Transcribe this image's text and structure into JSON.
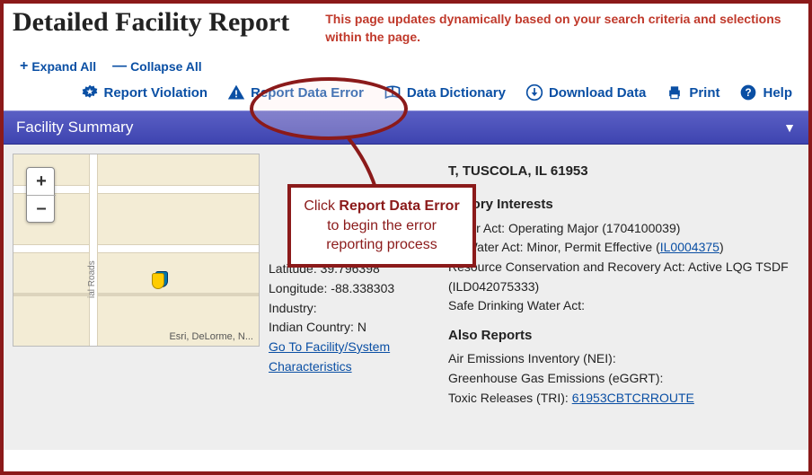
{
  "header": {
    "title": "Detailed Facility Report",
    "subtitle": "This page updates dynamically based on your search criteria and selections within the page."
  },
  "controls": {
    "expand_all": "Expand All",
    "collapse_all": "Collapse All"
  },
  "toolbar": {
    "report_violation": "Report Violation",
    "report_data_error": "Report Data Error",
    "data_dictionary": "Data Dictionary",
    "download_data": "Download Data",
    "print": "Print",
    "help": "Help"
  },
  "panel": {
    "title": "Facility Summary"
  },
  "map": {
    "zoom_in": "+",
    "zoom_out": "–",
    "attribution": "Esri, DeLorme, N...",
    "road_label": "ial Roads"
  },
  "facility": {
    "latitude_label": "Latitude:",
    "latitude": "39.796398",
    "longitude_label": "Longitude:",
    "longitude": "-88.338303",
    "industry_label": "Industry:",
    "industry": "",
    "indian_country_label": "Indian Country:",
    "indian_country": "N",
    "facility_link": "Go To Facility/System Characteristics",
    "address_suffix": "T, TUSCOLA, IL 61953"
  },
  "regulatory": {
    "heading_partial": "ulatory Interests",
    "caa_prefix": "an Air Act: ",
    "caa": "Operating Major (1704100039)",
    "cwa_prefix": "an Water Act: ",
    "cwa": "Minor, Permit Effective (",
    "cwa_link": "IL0004375",
    "cwa_suffix": ")",
    "rcra": "Resource Conservation and Recovery Act: Active LQG TSDF (ILD042075333)",
    "sdwa": "Safe Drinking Water Act:"
  },
  "also_reports": {
    "heading": "Also Reports",
    "nei": "Air Emissions Inventory (NEI):",
    "ghg": "Greenhouse Gas Emissions (eGGRT):",
    "tri_label": "Toxic Releases (TRI): ",
    "tri_link": "61953CBTCRROUTE"
  },
  "callout": {
    "text_pre": "Click ",
    "text_bold": "Report Data Error",
    "text_post": " to begin the error reporting process"
  }
}
